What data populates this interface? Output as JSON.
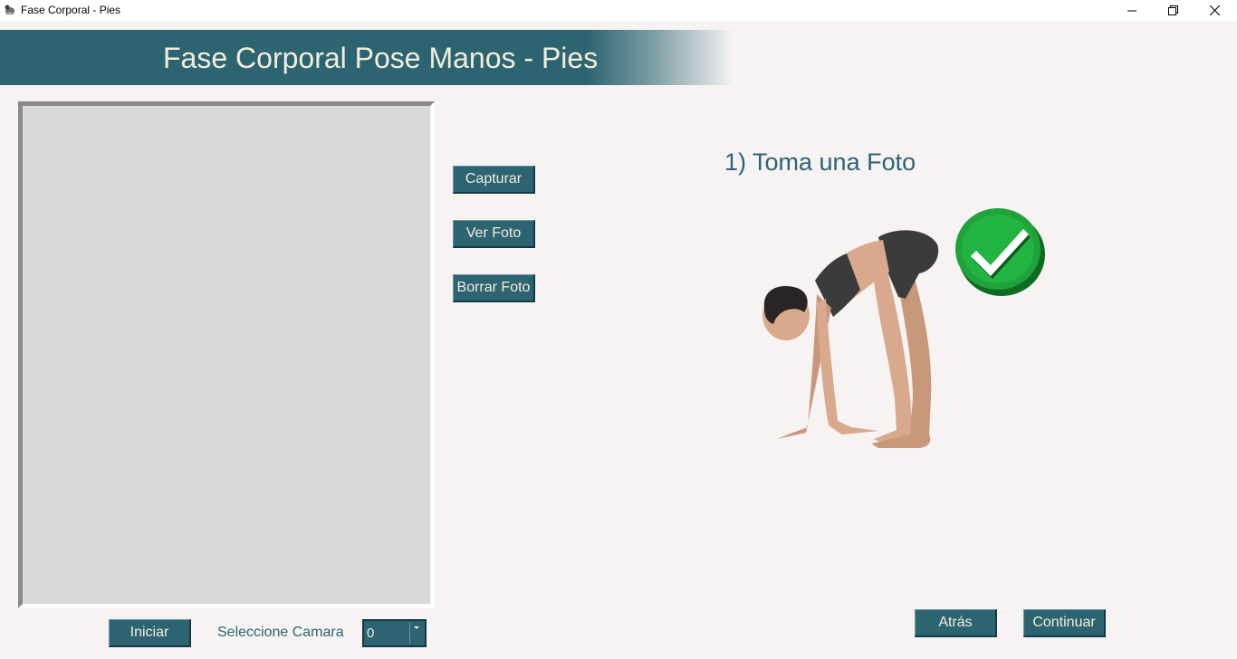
{
  "window": {
    "title": "Fase Corporal - Pies"
  },
  "header": {
    "title": "Fase Corporal Pose Manos - Pies"
  },
  "camera": {
    "start_label": "Iniciar",
    "select_label": "Seleccione Camara",
    "selected_camera": "0"
  },
  "actions": {
    "capture_label": "Capturar",
    "view_label": "Ver Foto",
    "delete_label": "Borrar Foto"
  },
  "instructions": {
    "step_title": "1) Toma una Foto"
  },
  "navigation": {
    "back_label": "Atrás",
    "continue_label": "Continuar"
  },
  "icons": {
    "app": "app-icon",
    "minimize": "minimize-icon",
    "maximize": "maximize-icon",
    "close": "close-icon",
    "check": "checkmark-icon",
    "dropdown": "chevron-down-icon"
  },
  "colors": {
    "accent": "#2c6472",
    "button_text": "#f3eedb",
    "background": "#f6f3f2",
    "check_green": "#1fa23a"
  }
}
